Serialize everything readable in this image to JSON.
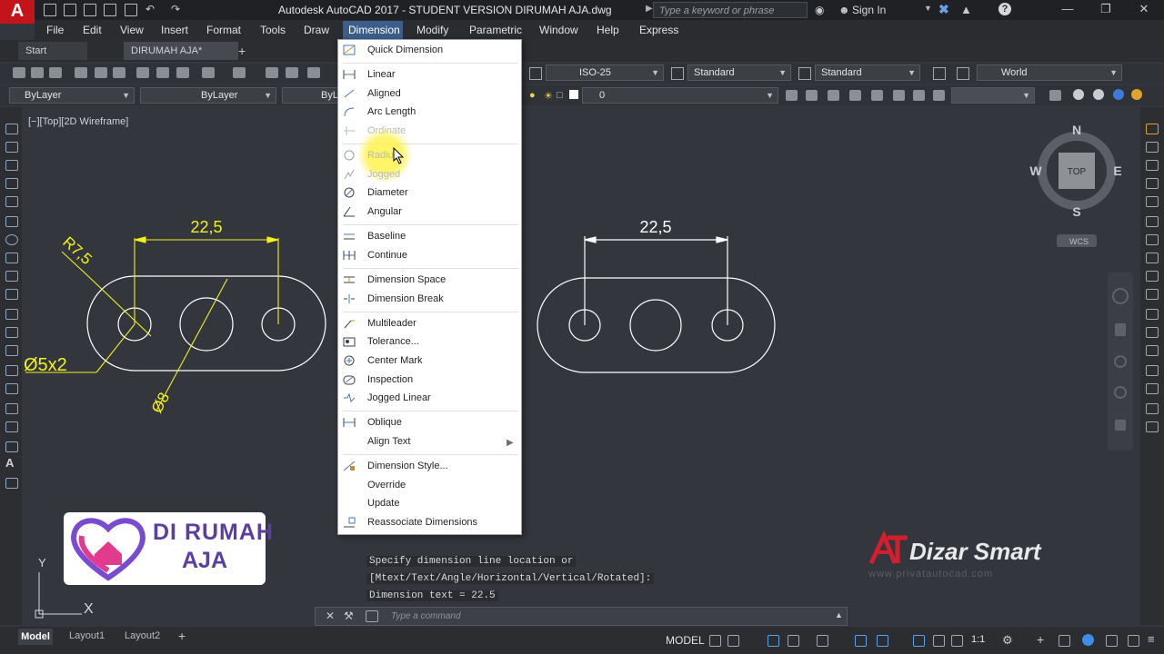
{
  "titlebar": {
    "title": "Autodesk AutoCAD 2017 - STUDENT VERSION    DIRUMAH AJA.dwg",
    "search_placeholder": "Type a keyword or phrase",
    "signin_label": "Sign In"
  },
  "menubar": {
    "items": [
      "File",
      "Edit",
      "View",
      "Insert",
      "Format",
      "Tools",
      "Draw",
      "Dimension",
      "Modify",
      "Parametric",
      "Window",
      "Help",
      "Express"
    ]
  },
  "file_tabs": {
    "start": "Start",
    "document": "DIRUMAH AJA*"
  },
  "toolbar": {
    "dimstyle": "ISO-25",
    "textstyle": "Standard",
    "tablestyle": "Standard",
    "ucs": "World",
    "layer_value": "0",
    "color": "ByLayer",
    "linetype": "ByLayer",
    "lineweight": "ByLa"
  },
  "viewport": {
    "label": "[−][Top][2D Wireframe]",
    "viewcube": {
      "top": "TOP",
      "n": "N",
      "s": "S",
      "e": "E",
      "w": "W",
      "wcs": "WCS"
    },
    "drawing_left": {
      "dim_top": "22,5",
      "radius_label": "R7,5",
      "hole_label": "Ø5x2",
      "diameter_label": "Ø8"
    },
    "drawing_right": {
      "dim_top": "22,5"
    },
    "axis": {
      "y": "Y",
      "x": "X"
    }
  },
  "dimension_menu": {
    "items": [
      {
        "label": "Quick Dimension",
        "icon": "quick-dimension-icon",
        "disabled": false
      },
      {
        "label": "Linear",
        "icon": "linear-icon",
        "disabled": false
      },
      {
        "label": "Aligned",
        "icon": "aligned-icon",
        "disabled": false
      },
      {
        "label": "Arc Length",
        "icon": "arc-length-icon",
        "disabled": false
      },
      {
        "label": "Ordinate",
        "icon": "ordinate-icon",
        "disabled": true
      },
      {
        "label": "Radius",
        "icon": "radius-icon",
        "disabled": true
      },
      {
        "label": "Jogged",
        "icon": "jogged-icon",
        "disabled": true
      },
      {
        "label": "Diameter",
        "icon": "diameter-icon",
        "disabled": false
      },
      {
        "label": "Angular",
        "icon": "angular-icon",
        "disabled": false
      },
      {
        "label": "Baseline",
        "icon": "baseline-icon",
        "disabled": false
      },
      {
        "label": "Continue",
        "icon": "continue-icon",
        "disabled": false
      },
      {
        "label": "Dimension Space",
        "icon": "dimension-space-icon",
        "disabled": false
      },
      {
        "label": "Dimension Break",
        "icon": "dimension-break-icon",
        "disabled": false
      },
      {
        "label": "Multileader",
        "icon": "multileader-icon",
        "disabled": false
      },
      {
        "label": "Tolerance...",
        "icon": "tolerance-icon",
        "disabled": false
      },
      {
        "label": "Center Mark",
        "icon": "center-mark-icon",
        "disabled": false
      },
      {
        "label": "Inspection",
        "icon": "inspection-icon",
        "disabled": false
      },
      {
        "label": "Jogged Linear",
        "icon": "jogged-linear-icon",
        "disabled": false
      },
      {
        "label": "Oblique",
        "icon": "oblique-icon",
        "disabled": false
      },
      {
        "label": "Align Text",
        "icon": "align-text-icon",
        "disabled": false,
        "submenu": true
      },
      {
        "label": "Dimension Style...",
        "icon": "dimension-style-icon",
        "disabled": false
      },
      {
        "label": "Override",
        "icon": "override-icon",
        "disabled": false
      },
      {
        "label": "Update",
        "icon": "update-icon",
        "disabled": false
      },
      {
        "label": "Reassociate Dimensions",
        "icon": "reassociate-icon",
        "disabled": false
      }
    ]
  },
  "command": {
    "history": [
      "Specify dimension line location or",
      "[Mtext/Text/Angle/Horizontal/Vertical/Rotated]:",
      "Dimension text = 22.5"
    ],
    "placeholder": "Type a command"
  },
  "layout_tabs": [
    "Model",
    "Layout1",
    "Layout2"
  ],
  "statusbar": {
    "model": "MODEL",
    "scale": "1:1"
  },
  "branding": {
    "logo_line1": "DI RUMAH",
    "logo_line2": "AJA",
    "dizar": "Dizar Smart",
    "dizar_url": "www.privatautocad.com"
  },
  "colors": {
    "dimension_yellow": "#f2f21a",
    "geometry_white": "#ffffff",
    "menu_highlight": "#3b5e8a",
    "autocad_red": "#c4141b"
  }
}
